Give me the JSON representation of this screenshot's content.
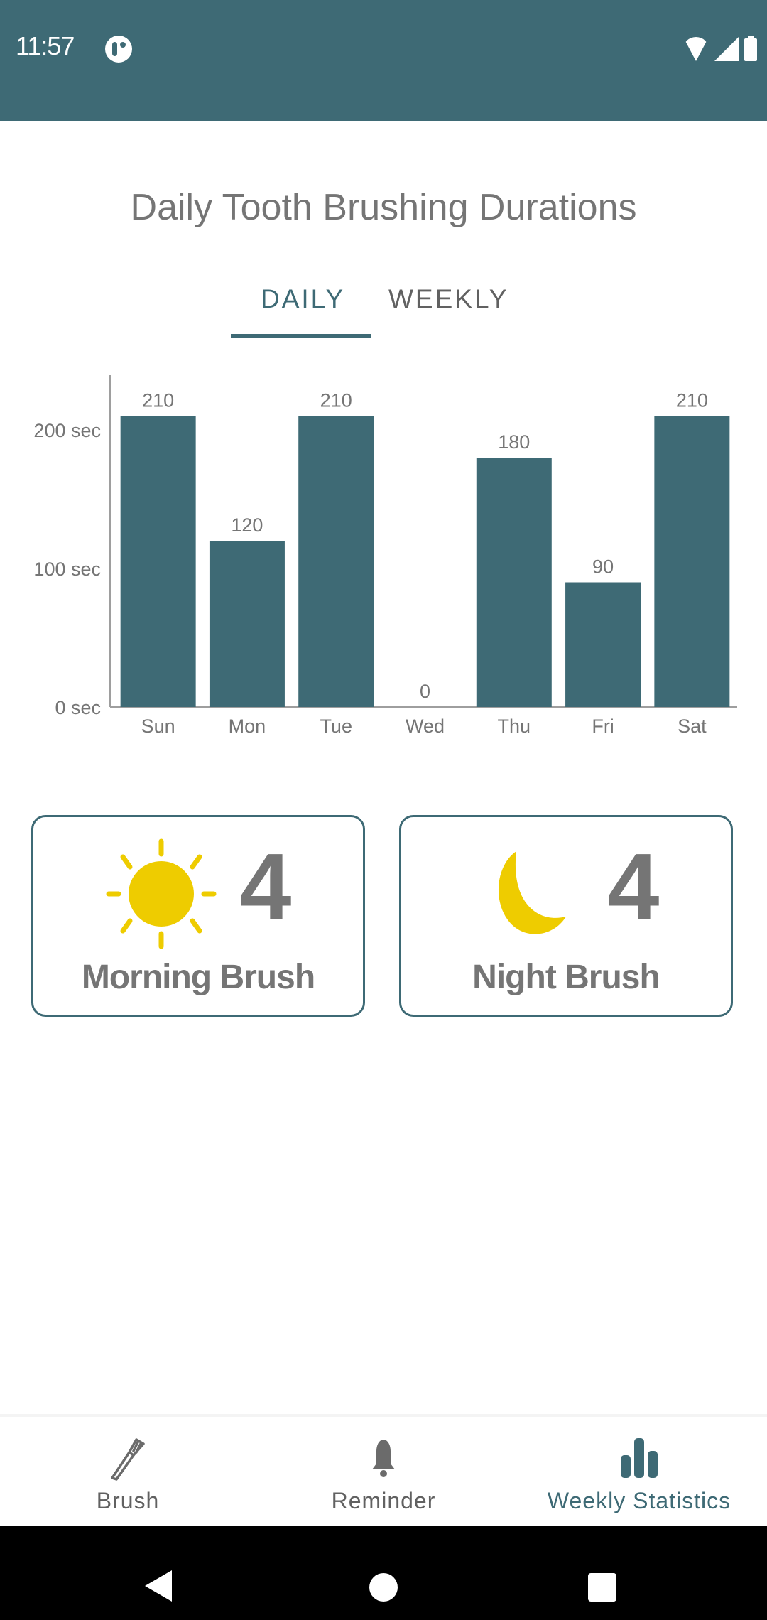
{
  "status_bar": {
    "time": "11:57",
    "icons": [
      "app-notification-icon",
      "wifi-icon",
      "cellular-signal-icon",
      "battery-icon"
    ]
  },
  "page": {
    "title": "Daily Tooth Brushing Durations"
  },
  "tabs": [
    {
      "label": "DAILY",
      "active": true
    },
    {
      "label": "WEEKLY",
      "active": false
    }
  ],
  "colors": {
    "primary": "#3e6a75",
    "text_gray": "#757575",
    "icon_yellow": "#eecc00",
    "nav_black": "#000000"
  },
  "chart_data": {
    "type": "bar",
    "title": "",
    "xlabel": "",
    "ylabel": "",
    "categories": [
      "Sun",
      "Mon",
      "Tue",
      "Wed",
      "Thu",
      "Fri",
      "Sat"
    ],
    "values": [
      210,
      120,
      210,
      0,
      180,
      90,
      210
    ],
    "value_labels": [
      "210",
      "120",
      "210",
      "0",
      "180",
      "90",
      "210"
    ],
    "y_ticks": [
      0,
      100,
      200
    ],
    "y_tick_labels": [
      "0 sec",
      "100 sec",
      "200 sec"
    ],
    "ylim": [
      0,
      240
    ],
    "grid": false,
    "legend": "none",
    "bar_color": "#3e6a75"
  },
  "summary_cards": [
    {
      "icon": "sun-icon",
      "count": "4",
      "label": "Morning Brush"
    },
    {
      "icon": "moon-icon",
      "count": "4",
      "label": "Night Brush"
    }
  ],
  "bottom_nav": [
    {
      "label": "Brush",
      "icon": "toothbrush-icon",
      "active": false
    },
    {
      "label": "Reminder",
      "icon": "bell-icon",
      "active": false
    },
    {
      "label": "Weekly Statistics",
      "icon": "bar-chart-icon",
      "active": true
    }
  ],
  "system_nav": [
    "back-button",
    "home-button",
    "recents-button"
  ]
}
